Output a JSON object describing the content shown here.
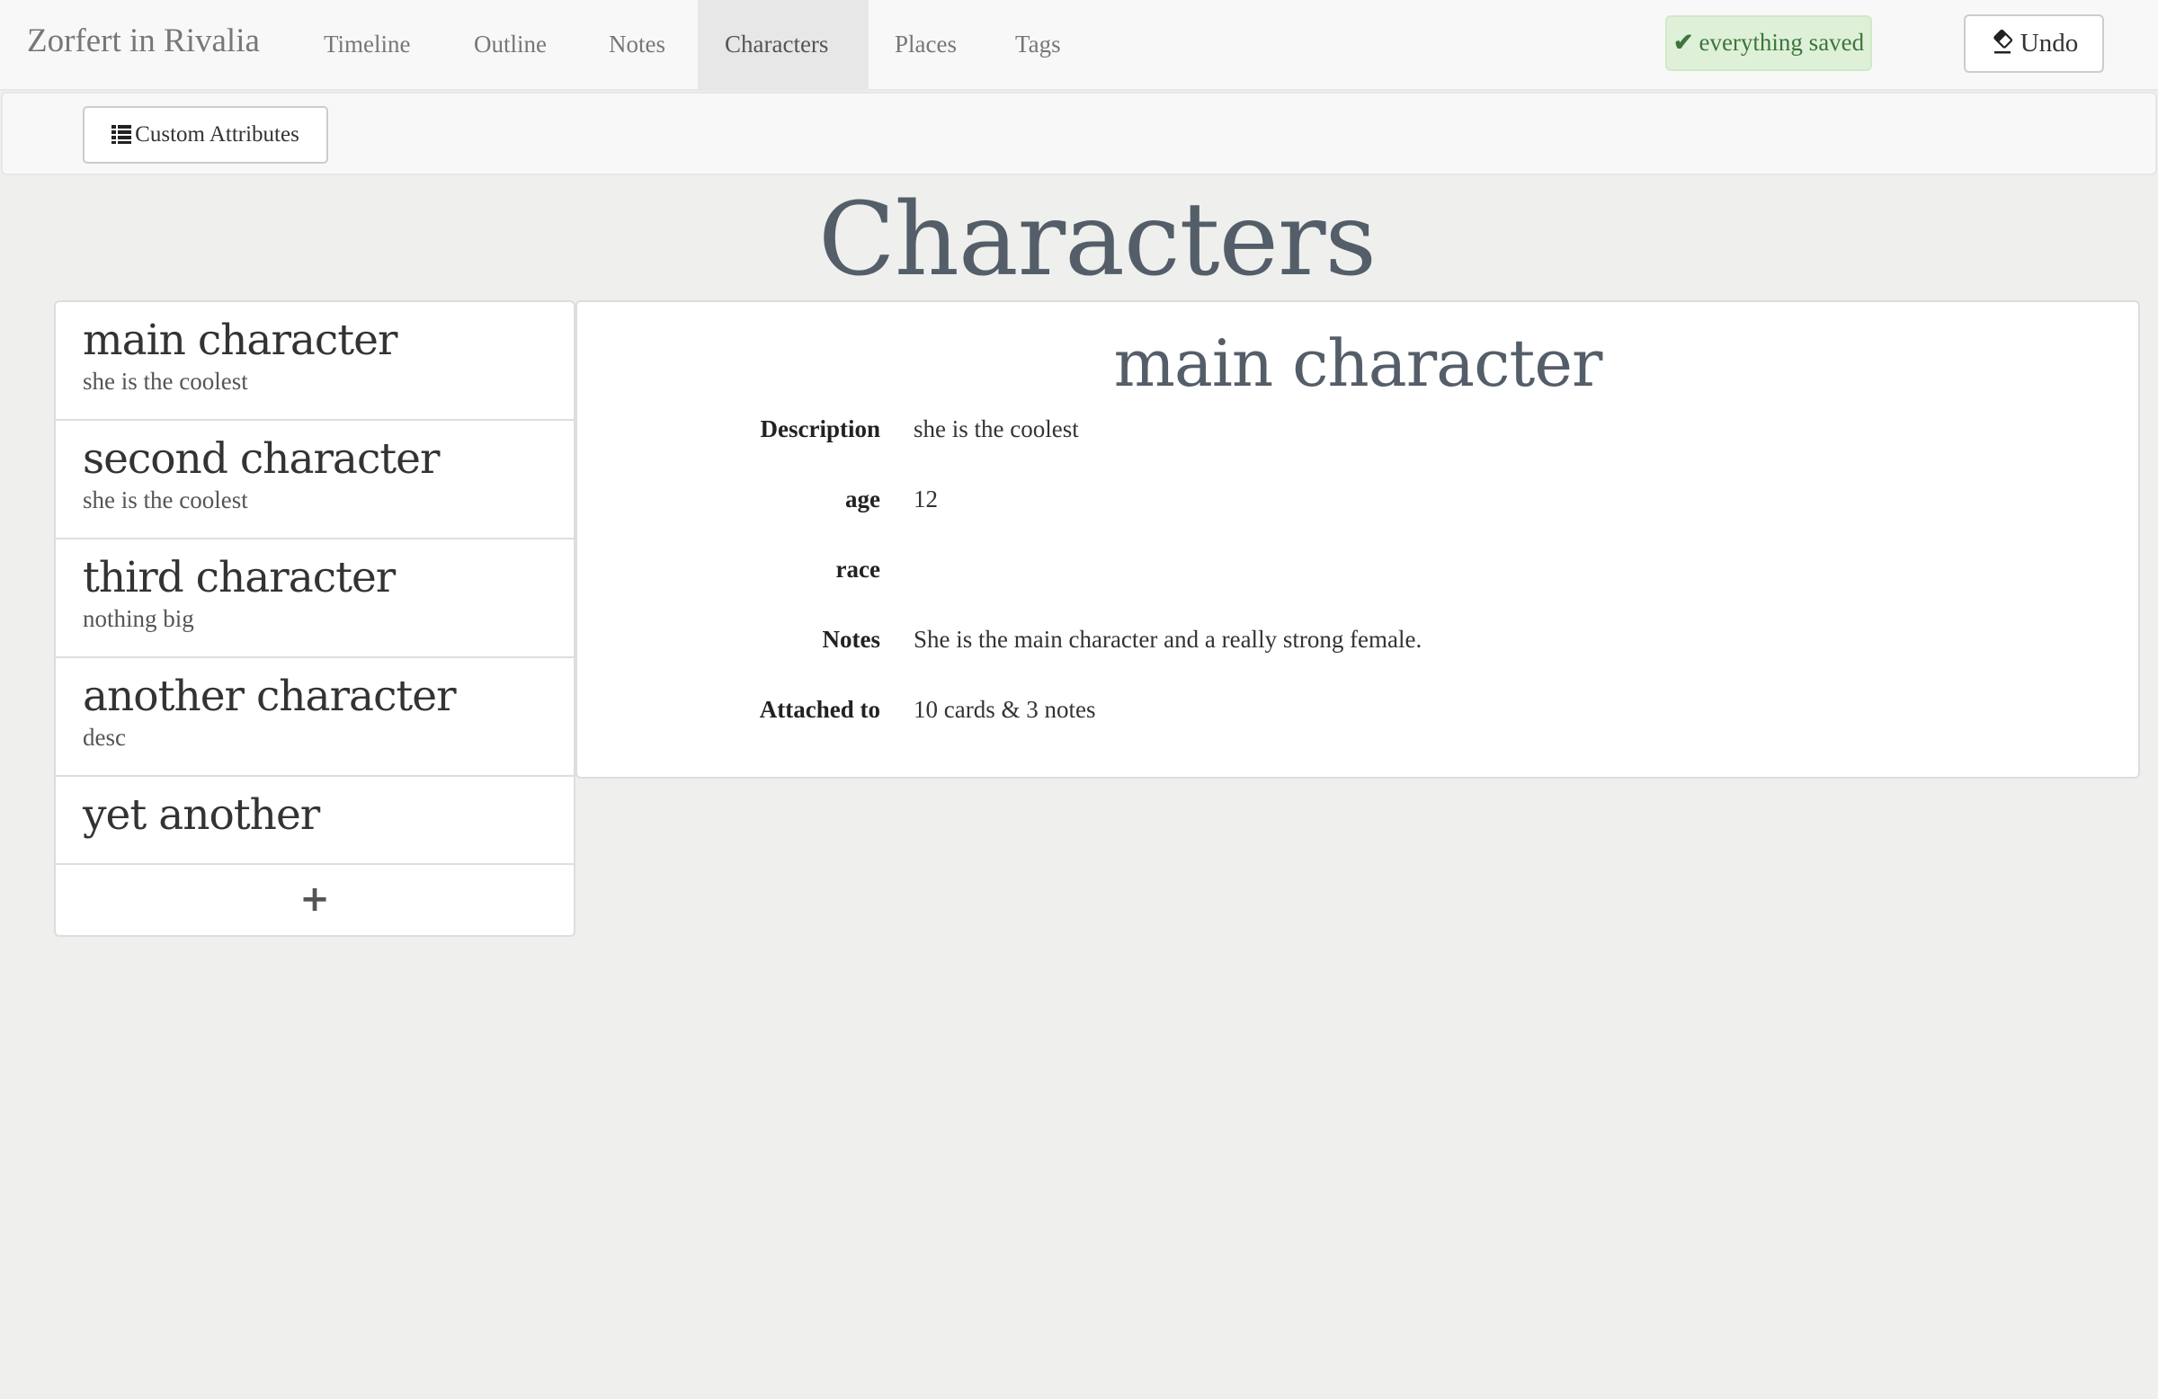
{
  "navbar": {
    "brand": "Zorfert in Rivalia",
    "tabs": [
      {
        "label": "Timeline",
        "active": false
      },
      {
        "label": "Outline",
        "active": false
      },
      {
        "label": "Notes",
        "active": false
      },
      {
        "label": "Characters",
        "active": true
      },
      {
        "label": "Places",
        "active": false
      },
      {
        "label": "Tags",
        "active": false
      }
    ],
    "save_status": {
      "icon": "check-icon",
      "label": "everything saved",
      "color": "#3c763d"
    },
    "undo": {
      "icon": "eraser-icon",
      "label": "Undo"
    }
  },
  "subbar": {
    "custom_attributes": {
      "icon": "list-icon",
      "label": "Custom Attributes"
    }
  },
  "page": {
    "title": "Characters"
  },
  "characters": [
    {
      "name": "main character",
      "description": "she is the coolest"
    },
    {
      "name": "second character",
      "description": "she is the coolest"
    },
    {
      "name": "third character",
      "description": "nothing big"
    },
    {
      "name": "another character",
      "description": "desc"
    },
    {
      "name": "yet another",
      "description": ""
    }
  ],
  "add_button": {
    "icon": "plus-icon",
    "label": "+"
  },
  "detail": {
    "title": "main character",
    "attributes": [
      {
        "label": "Description",
        "value": "she is the coolest"
      },
      {
        "label": "age",
        "value": "12"
      },
      {
        "label": "race",
        "value": ""
      },
      {
        "label": "Notes",
        "value": "She is the main character and a really strong female."
      },
      {
        "label": "Attached to",
        "value": "10 cards & 3 notes"
      }
    ]
  }
}
